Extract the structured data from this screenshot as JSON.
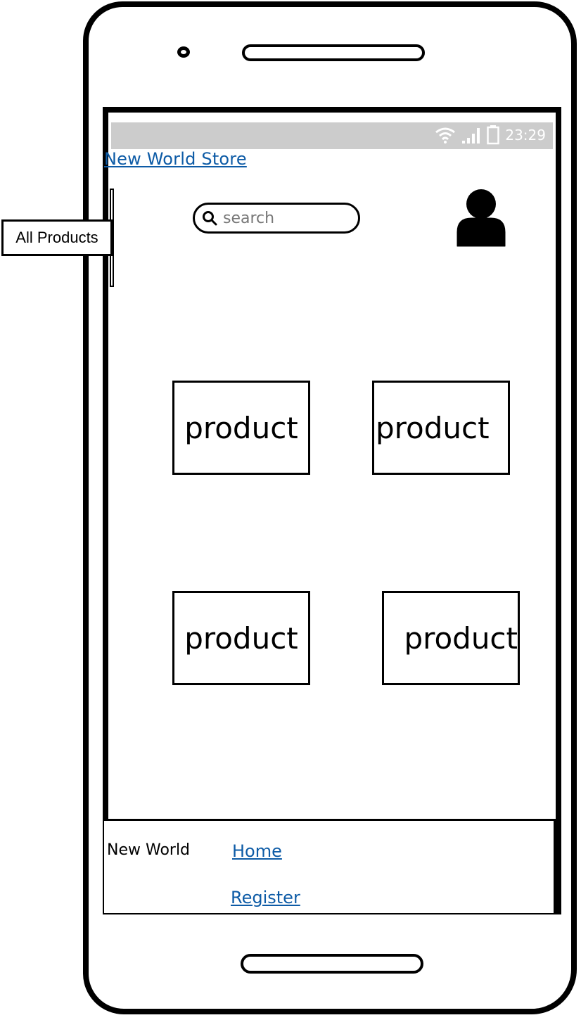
{
  "status_bar": {
    "time": "23:29",
    "icons": [
      "wifi-icon",
      "signal-icon",
      "battery-icon"
    ]
  },
  "header": {
    "store_link": "New World Store"
  },
  "search": {
    "placeholder": "search",
    "icon": "search-icon"
  },
  "profile": {
    "icon": "user-avatar-icon"
  },
  "side_tab": {
    "label": "All Products"
  },
  "products": [
    {
      "label": "product"
    },
    {
      "label": "product"
    },
    {
      "label": "product"
    },
    {
      "label": "product"
    }
  ],
  "footer": {
    "brand": "New World",
    "links": [
      {
        "label": "Home"
      },
      {
        "label": "Register"
      }
    ]
  },
  "colors": {
    "link": "#0d5ba6",
    "status_bar": "#cccccc",
    "outline": "#000000"
  }
}
